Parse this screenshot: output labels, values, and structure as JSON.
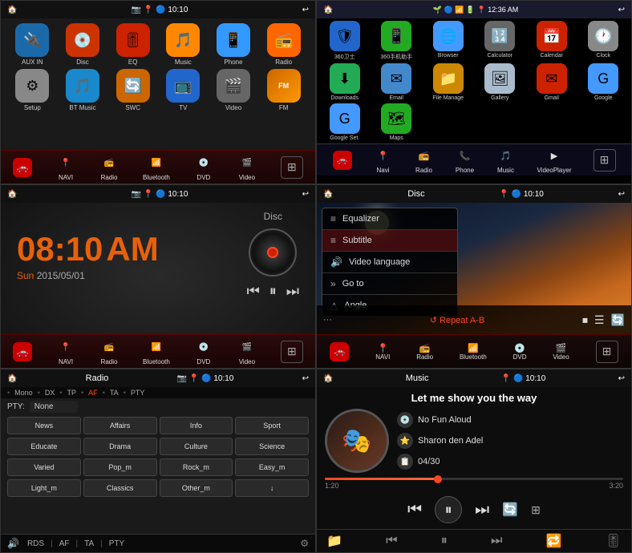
{
  "panel1": {
    "statusBar": {
      "time": "10:10",
      "title": ""
    },
    "apps": [
      {
        "label": "AUX IN",
        "color": "#1a6aaa",
        "icon": "🔌"
      },
      {
        "label": "Disc",
        "color": "#cc3300",
        "icon": "💿"
      },
      {
        "label": "EQ",
        "color": "#cc2200",
        "icon": "🎚"
      },
      {
        "label": "Music",
        "color": "#ff8800",
        "icon": "🎵"
      },
      {
        "label": "Phone",
        "color": "#3399ff",
        "icon": "📱"
      },
      {
        "label": "Radio",
        "color": "#ff6600",
        "icon": "📻"
      },
      {
        "label": "Setup",
        "color": "#888888",
        "icon": "⚙"
      },
      {
        "label": "BT Music",
        "color": "#1a88cc",
        "icon": "🎵"
      },
      {
        "label": "SWC",
        "color": "#cc6600",
        "icon": "🔄"
      },
      {
        "label": "TV",
        "color": "#2266cc",
        "icon": "📺"
      },
      {
        "label": "Video",
        "color": "#666666",
        "icon": "🎬"
      }
    ],
    "navItems": [
      {
        "label": "NAVI",
        "icon": "📍"
      },
      {
        "label": "Radio",
        "icon": "📻"
      },
      {
        "label": "Bluetooth",
        "icon": "📶"
      },
      {
        "label": "DVD",
        "icon": "💿"
      },
      {
        "label": "Video",
        "icon": "🎬"
      }
    ]
  },
  "panel2": {
    "statusBar": {
      "time": "12:36 AM"
    },
    "apps": [
      {
        "label": "360卫士",
        "color": "#2266cc",
        "icon": "🛡"
      },
      {
        "label": "360手机助手",
        "color": "#22aa22",
        "icon": "📱"
      },
      {
        "label": "Browser",
        "color": "#4499ff",
        "icon": "🌐"
      },
      {
        "label": "Calculator",
        "color": "#666",
        "icon": "🔢"
      },
      {
        "label": "Calendar",
        "color": "#cc2200",
        "icon": "📅"
      },
      {
        "label": "Clock",
        "color": "#888",
        "icon": "🕐"
      },
      {
        "label": "Downloads",
        "color": "#22aa55",
        "icon": "⬇"
      },
      {
        "label": "Email",
        "color": "#4488cc",
        "icon": "✉"
      },
      {
        "label": "File Manage",
        "color": "#cc8800",
        "icon": "📁"
      },
      {
        "label": "Gallery",
        "color": "#aabbcc",
        "icon": "🖼"
      },
      {
        "label": "Gmail",
        "color": "#cc2200",
        "icon": "✉"
      },
      {
        "label": "Google",
        "color": "#4499ff",
        "icon": "G"
      },
      {
        "label": "Google Set.",
        "color": "#4499ff",
        "icon": "G"
      },
      {
        "label": "Maps",
        "color": "#22aa22",
        "icon": "🗺"
      },
      {
        "label": "Navi",
        "color": "#2255aa",
        "icon": "📍"
      },
      {
        "label": "Radio",
        "color": "#ff6600",
        "icon": "📻"
      },
      {
        "label": "Phone",
        "color": "#22aa22",
        "icon": "📞"
      },
      {
        "label": "Music",
        "color": "#ff8800",
        "icon": "🎵"
      },
      {
        "label": "VideoPlayer",
        "color": "#cc4400",
        "icon": "▶"
      }
    ],
    "navItems": [
      {
        "label": "Navi",
        "icon": "📍"
      },
      {
        "label": "Radio",
        "icon": "📻"
      },
      {
        "label": "Phone",
        "icon": "📞"
      },
      {
        "label": "Music",
        "icon": "🎵"
      },
      {
        "label": "VideoPlayer",
        "icon": "▶"
      }
    ]
  },
  "panel3": {
    "statusBar": {
      "time": "10:10"
    },
    "clock": {
      "time": "08:10",
      "ampm": "AM",
      "day": "Sun",
      "date": "2015/05/01"
    },
    "disc": {
      "label": "Disc"
    },
    "navItems": [
      {
        "label": "NAVI",
        "icon": "📍"
      },
      {
        "label": "Radio",
        "icon": "📻"
      },
      {
        "label": "Bluetooth",
        "icon": "📶"
      },
      {
        "label": "DVD",
        "icon": "💿"
      },
      {
        "label": "Video",
        "icon": "🎬"
      }
    ]
  },
  "panel4": {
    "statusBar": {
      "title": "Disc",
      "time": "10:10"
    },
    "menu": [
      {
        "label": "Equalizer",
        "icon": "≡"
      },
      {
        "label": "Subtitle",
        "icon": "≡"
      },
      {
        "label": "Video language",
        "icon": "🔊"
      },
      {
        "label": "Go to",
        "icon": "»"
      },
      {
        "label": "Angle",
        "icon": "△"
      }
    ],
    "navItems": [
      {
        "label": "NAVI",
        "icon": "📍"
      },
      {
        "label": "Radio",
        "icon": "📻"
      },
      {
        "label": "Bluetooth",
        "icon": "📶"
      },
      {
        "label": "DVD",
        "icon": "💿"
      },
      {
        "label": "Video",
        "icon": "🎬"
      }
    ]
  },
  "panel5": {
    "statusBar": {
      "title": "Radio",
      "time": "10:10"
    },
    "options": [
      "Mono",
      "DX",
      "TP",
      "AF",
      "TA",
      "PTY"
    ],
    "activeOptions": [
      "AF"
    ],
    "pty": "None",
    "genres": [
      [
        "News",
        "Affairs",
        "Info",
        "Sport"
      ],
      [
        "Educate",
        "Drama",
        "Culture",
        "Science"
      ],
      [
        "Varied",
        "Pop_m",
        "Rock_m",
        "Easy_m"
      ],
      [
        "Light_m",
        "Classics",
        "Other_m",
        "↓"
      ]
    ],
    "bottomBtns": [
      "RDS",
      "AF",
      "TA",
      "PTY"
    ]
  },
  "panel6": {
    "statusBar": {
      "title": "Music",
      "time": "10:10"
    },
    "songTitle": "Let me show you the way",
    "artist1": "No Fun Aloud",
    "artist2": "Sharon den Adel",
    "track": "04/30",
    "progress": 38,
    "timeElapsed": "1:20",
    "timeTotal": "3:20"
  }
}
